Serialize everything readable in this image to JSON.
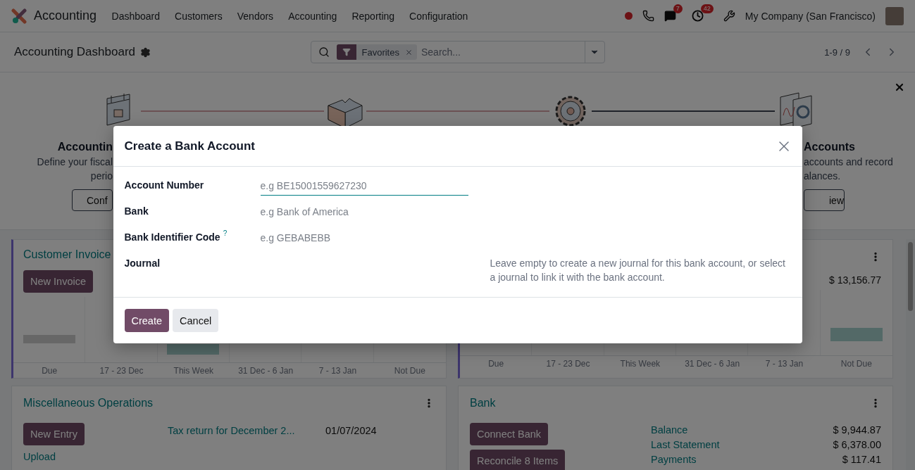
{
  "navbar": {
    "app_name": "Accounting",
    "menu": [
      "Dashboard",
      "Customers",
      "Vendors",
      "Accounting",
      "Reporting",
      "Configuration"
    ],
    "chat_count": "7",
    "activity_count": "42",
    "company": "My Company (San Francisco)"
  },
  "control_panel": {
    "title": "Accounting Dashboard",
    "facet": "Favorites",
    "search_placeholder": "Search...",
    "pager": "1-9 / 9"
  },
  "onboarding": {
    "left_step": {
      "title": "Accountin",
      "lines": [
        "Define your fiscal",
        "perio"
      ],
      "button": "Conf"
    },
    "right_step": {
      "title": "Accounts",
      "lines": [
        "accounts and record",
        "alances."
      ],
      "button": "iew"
    }
  },
  "cards": [
    {
      "kind": "invoices",
      "title": "Customer Invoice",
      "has_menu": false,
      "buttons": [
        "New Invoice"
      ],
      "chart": {
        "labels": [
          "Due",
          "17 - 23 Dec",
          "This Week",
          "31 Dec - 6 Jan",
          "7 - 13 Jan",
          "Not Due"
        ]
      }
    },
    {
      "kind": "invoices",
      "has_menu": true,
      "amount": "$ 13,156.77",
      "chart": {
        "labels": [
          "Due",
          "17 - 23 Dec",
          "This Week",
          "31 Dec - 6 Jan",
          "7 - 13 Jan",
          "Not Due"
        ]
      }
    },
    {
      "kind": "misc",
      "title": "Miscellaneous Operations",
      "has_menu": true,
      "buttons": [
        "New Entry"
      ],
      "link": "Upload",
      "entry": {
        "label": "Tax return for December 2...",
        "date": "01/07/2024"
      }
    },
    {
      "kind": "bank",
      "title": "Bank",
      "has_menu": true,
      "buttons": [
        "Connect Bank",
        "Reconcile 8 Items"
      ],
      "stats": [
        {
          "label": "Balance",
          "value": "$ 9,944.87"
        },
        {
          "label": "Last Statement",
          "value": "$ 6,378.00"
        },
        {
          "label": "Payments",
          "value": "$ 117.41"
        }
      ]
    }
  ],
  "dialog": {
    "title": "Create a Bank Account",
    "fields": [
      {
        "label": "Account Number",
        "placeholder": "e.g BE15001559627230",
        "focused": true
      },
      {
        "label": "Bank",
        "placeholder": "e.g Bank of America",
        "focused": false
      },
      {
        "label": "Bank Identifier Code",
        "help_mark": "?",
        "placeholder": "e.g GEBABEBB",
        "focused": false
      },
      {
        "label": "Journal",
        "focused": false,
        "help": "Leave empty to create a new journal for this bank account, or select a journal to link it with the bank account."
      }
    ],
    "buttons": [
      {
        "label": "Create",
        "kind": "primary"
      },
      {
        "label": "Cancel",
        "kind": "secondary"
      }
    ]
  }
}
